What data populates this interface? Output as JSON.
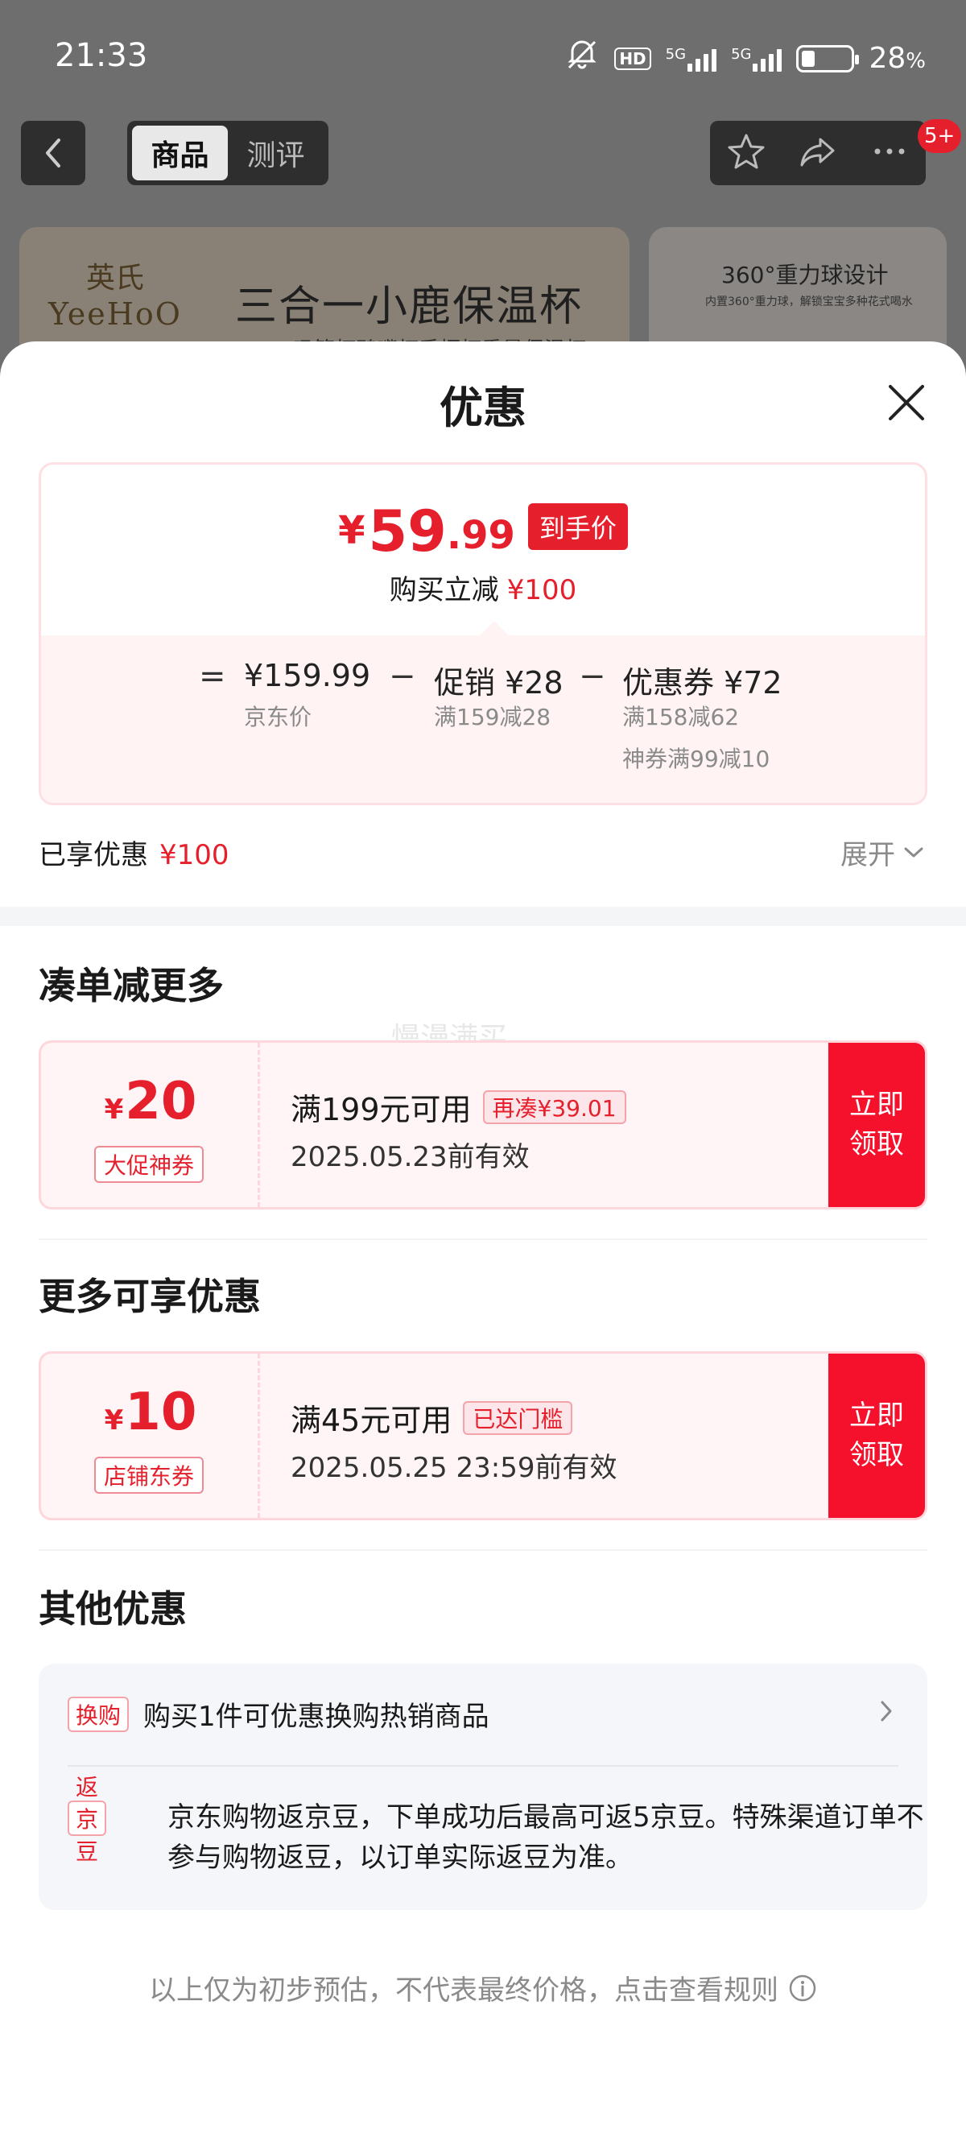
{
  "status_bar": {
    "time": "21:33",
    "network_1": "5G",
    "network_2": "5G",
    "hd_label": "HD",
    "battery_percent": "28",
    "battery_unit": "%",
    "battery_level": 0.28
  },
  "nav": {
    "tabs": [
      {
        "label": "商品",
        "active": true
      },
      {
        "label": "测评",
        "active": false
      }
    ],
    "badge": "5+"
  },
  "banner": {
    "logo_cn": "英氏",
    "logo_en": "YeeHoO",
    "title": "三合一小鹿保温杯",
    "subtitle": "吸管杯鸭嘴杯手柄杯重量保温杯",
    "side_title": "360°重力球设计",
    "side_subtitle": "内置360°重力球，解锁宝宝多种花式喝水"
  },
  "sheet": {
    "title": "优惠",
    "price": {
      "currency": "¥",
      "integer": "59",
      "decimal": ".99",
      "tag": "到手价",
      "reduce_text": "购买立减",
      "reduce_amount": "¥100"
    },
    "calc": {
      "equals": "=",
      "minus": "−",
      "jd_price": "¥159.99",
      "jd_price_label": "京东价",
      "promo": "促销 ¥28",
      "promo_rule": "满159减28",
      "coupon": "优惠券 ¥72",
      "coupon_rule_1": "满158减62",
      "coupon_rule_2": "神券满99减10"
    },
    "enjoyed_label": "已享优惠",
    "enjoyed_amount": "¥100",
    "expand_label": "展开",
    "watermark": "慢漫满买",
    "section_more": "凑单减更多",
    "coupon1": {
      "currency": "¥",
      "value": "20",
      "kind": "大促神券",
      "condition": "满199元可用",
      "chip": "再凑¥39.01",
      "valid": "2025.05.23前有效",
      "get_label_1": "立即",
      "get_label_2": "领取"
    },
    "section_extra": "更多可享优惠",
    "coupon2": {
      "currency": "¥",
      "value": "10",
      "kind": "店铺东券",
      "condition": "满45元可用",
      "chip": "已达门槛",
      "valid": "2025.05.25 23:59前有效",
      "get_label_1": "立即",
      "get_label_2": "领取"
    },
    "section_other": "其他优惠",
    "other": {
      "exchange_label": "换购",
      "exchange_text": "购买1件可优惠换购热销商品",
      "bean_label": "返京豆",
      "bean_text": "京东购物返京豆，下单成功后最高可返5京豆。特殊渠道订单不参与购物返豆，以订单实际返豆为准。"
    },
    "footer": "以上仅为初步预估，不代表最终价格，点击查看规则"
  },
  "colors": {
    "accent": "#e5202c",
    "get_button": "#f5102c",
    "coupon_bg": "#fff5f6"
  }
}
